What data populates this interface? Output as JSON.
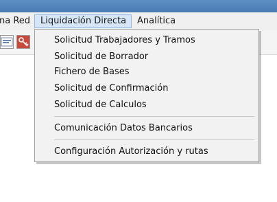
{
  "menubar": {
    "items": [
      {
        "label": "na Red"
      },
      {
        "label": "Liquidación Directa"
      },
      {
        "label": "Analítica"
      }
    ]
  },
  "toolbar": {
    "buttons": [
      {
        "icon": "document-edit-icon"
      },
      {
        "icon": "key-icon"
      }
    ]
  },
  "dropdown": {
    "items": [
      {
        "label": "Solicitud Trabajadores y Tramos"
      },
      {
        "label": "Solicitud de Borrador"
      },
      {
        "label": "Fichero de Bases"
      },
      {
        "label": "Solicitud de Confirmación"
      },
      {
        "label": "Solicitud de Calculos"
      },
      {
        "label": "Comunicación Datos Bancarios"
      },
      {
        "label": "Configuración Autorización y rutas"
      }
    ]
  },
  "colors": {
    "menubar_bg": "#f0f0f0",
    "active_menu_bg": "#d6e6f7",
    "active_menu_border": "#8fb8e4",
    "dropdown_bg": "#f2f2f2",
    "titlebar": "#4a7bb3"
  }
}
